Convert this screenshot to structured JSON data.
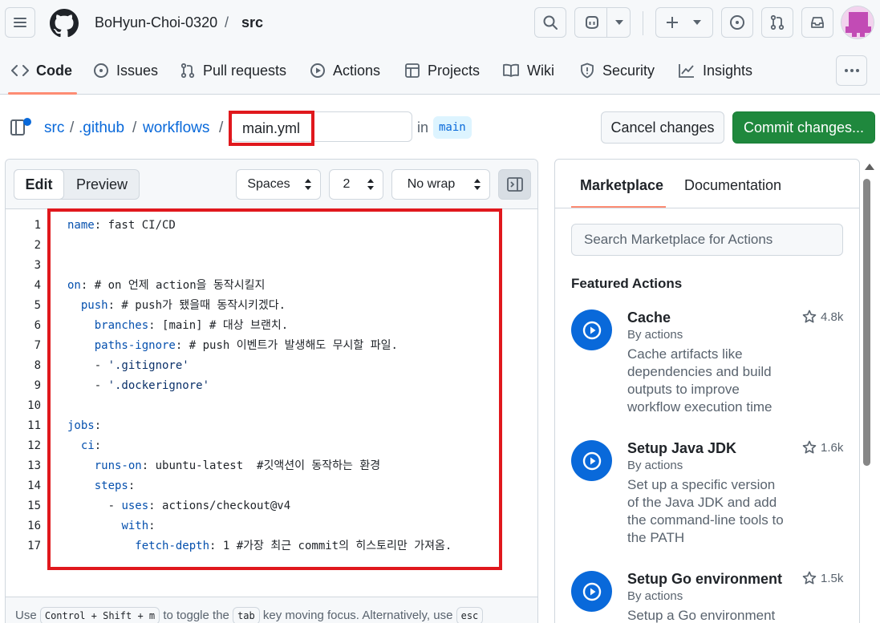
{
  "header": {
    "owner": "BoHyun-Choi-0320",
    "separator": "/",
    "repo": "src"
  },
  "repo_nav": [
    {
      "label": "Code",
      "icon": "code-icon"
    },
    {
      "label": "Issues",
      "icon": "issue-opened-icon"
    },
    {
      "label": "Pull requests",
      "icon": "git-pull-request-icon"
    },
    {
      "label": "Actions",
      "icon": "play-icon"
    },
    {
      "label": "Projects",
      "icon": "table-icon"
    },
    {
      "label": "Wiki",
      "icon": "book-icon"
    },
    {
      "label": "Security",
      "icon": "shield-icon"
    },
    {
      "label": "Insights",
      "icon": "graph-icon"
    }
  ],
  "path": {
    "parts": [
      "src",
      ".github",
      "workflows"
    ],
    "sep": "/",
    "filename": "main.yml",
    "in_label": "in",
    "branch": "main"
  },
  "buttons": {
    "cancel": "Cancel changes",
    "commit": "Commit changes..."
  },
  "editor": {
    "tab_edit": "Edit",
    "tab_preview": "Preview",
    "indent_mode": "Spaces",
    "indent_size": "2",
    "wrap_mode": "No wrap",
    "lines": [
      "name: fast CI/CD",
      "",
      "",
      "on: # on 언제 action을 동작시킬지",
      "  push: # push가 됐을때 동작시키겠다.",
      "    branches: [main] # 대상 브랜치.",
      "    paths-ignore: # push 이벤트가 발생해도 무시할 파일.",
      "    - '.gitignore'",
      "    - '.dockerignore'",
      "",
      "jobs:",
      "  ci:",
      "    runs-on: ubuntu-latest  #깃액션이 동작하는 환경",
      "    steps:",
      "      - uses: actions/checkout@v4",
      "        with:",
      "          fetch-depth: 1 #가장 최근 commit의 히스토리만 가져옴."
    ],
    "footer": {
      "t1": "Use",
      "k1": "Control + Shift + m",
      "t2": "to toggle the",
      "k2": "tab",
      "t3": "key moving focus. Alternatively, use",
      "k3": "esc"
    }
  },
  "sidebar": {
    "tab_marketplace": "Marketplace",
    "tab_docs": "Documentation",
    "search_placeholder": "Search Marketplace for Actions",
    "featured_heading": "Featured Actions",
    "actions": [
      {
        "title": "Cache",
        "by": "By actions",
        "desc": "Cache artifacts like dependencies and build outputs to improve workflow execution time",
        "stars": "4.8k"
      },
      {
        "title": "Setup Java JDK",
        "by": "By actions",
        "desc": "Set up a specific version of the Java JDK and add the command-line tools to the PATH",
        "stars": "1.6k"
      },
      {
        "title": "Setup Go environment",
        "by": "By actions",
        "desc": "Setup a Go environment",
        "stars": "1.5k"
      }
    ]
  },
  "colors": {
    "accent_blue": "#0969da",
    "commit_green": "#1f883d",
    "highlight_red": "#e0181d",
    "nav_underline": "#fd8c73"
  }
}
